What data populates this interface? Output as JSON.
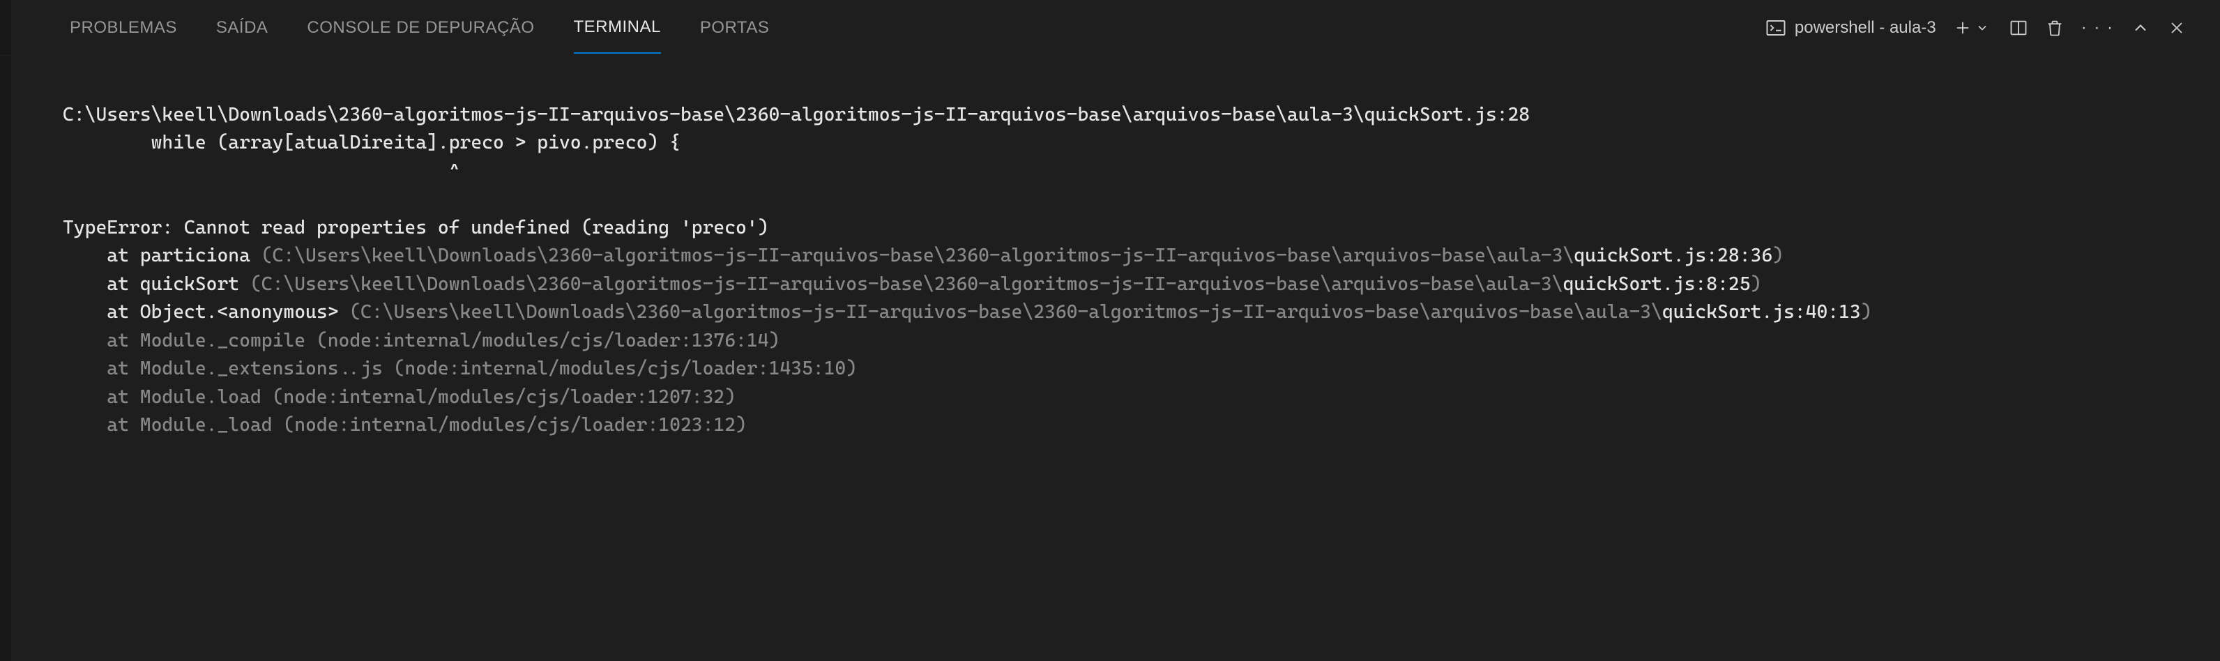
{
  "tabs": {
    "problemas": "PROBLEMAS",
    "saida": "SAÍDA",
    "depuracao": "CONSOLE DE DEPURAÇÃO",
    "terminal": "TERMINAL",
    "portas": "PORTAS"
  },
  "toolbar": {
    "terminal_label": "powershell - aula-3"
  },
  "terminal": {
    "lines": [
      {
        "cls": "white-text",
        "text": "C:\\Users\\keell\\Downloads\\2360-algoritmos-js-II-arquivos-base\\2360-algoritmos-js-II-arquivos-base\\arquivos-base\\aula-3\\quickSort.js:28"
      },
      {
        "cls": "white-text",
        "text": "        while (array[atualDireita].preco > pivo.preco) {"
      },
      {
        "cls": "white-text",
        "text": "                                   ^"
      },
      {
        "cls": "white-text",
        "text": ""
      },
      {
        "cls": "white-text",
        "text": "TypeError: Cannot read properties of undefined (reading 'preco')"
      },
      {
        "cls": "mixed1",
        "text": ""
      },
      {
        "cls": "mixed2",
        "text": ""
      },
      {
        "cls": "mixed3",
        "text": ""
      },
      {
        "cls": "gray-text",
        "text": "    at Module._compile (node:internal/modules/cjs/loader:1376:14)"
      },
      {
        "cls": "gray-text",
        "text": "    at Module._extensions..js (node:internal/modules/cjs/loader:1435:10)"
      },
      {
        "cls": "gray-text",
        "text": "    at Module.load (node:internal/modules/cjs/loader:1207:32)"
      },
      {
        "cls": "gray-text",
        "text": "    at Module._load (node:internal/modules/cjs/loader:1023:12)"
      }
    ],
    "stack_parts": {
      "l1_a": "    at particiona ",
      "l1_b": "(C:\\Users\\keell\\Downloads\\2360-algoritmos-js-II-arquivos-base\\2360-algoritmos-js-II-arquivos-base\\arquivos-base\\aula-3\\",
      "l1_c": "quickSort.js:28:36",
      "l1_d": ")",
      "l2_a": "    at quickSort ",
      "l2_b": "(C:\\Users\\keell\\Downloads\\2360-algoritmos-js-II-arquivos-base\\2360-algoritmos-js-II-arquivos-base\\arquivos-base\\aula-3\\",
      "l2_c": "quickSort.js:8:25",
      "l2_d": ")",
      "l3_a": "    at Object.<anonymous> ",
      "l3_b": "(C:\\Users\\keell\\Downloads\\2360-algoritmos-js-II-arquivos-base\\2360-algoritmos-js-II-arquivos-base\\arquivos-base\\aula-3\\",
      "l3_c": "quickSort.js:40:13",
      "l3_d": ")"
    }
  }
}
